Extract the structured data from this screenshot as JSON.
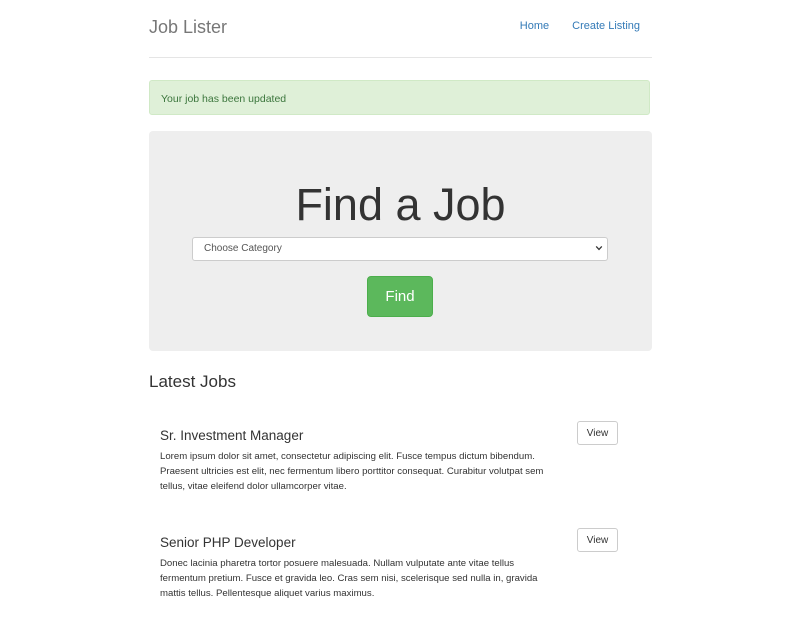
{
  "header": {
    "brand": "Job Lister",
    "nav": [
      "Home",
      "Create Listing"
    ]
  },
  "alert": {
    "message": "Your job has been updated"
  },
  "search": {
    "title": "Find a Job",
    "category_selected": "Choose Category",
    "find_label": "Find"
  },
  "latest": {
    "title": "Latest Jobs",
    "jobs": [
      {
        "title": "Sr. Investment Manager",
        "description": "Lorem ipsum dolor sit amet, consectetur adipiscing elit. Fusce tempus dictum bibendum. Praesent ultricies est elit, nec fermentum libero porttitor consequat. Curabitur volutpat sem tellus, vitae eleifend dolor ullamcorper vitae.",
        "action": "View"
      },
      {
        "title": "Senior PHP Developer",
        "description": "Donec lacinia pharetra tortor posuere malesuada. Nullam vulputate ante vitae tellus fermentum pretium. Fusce et gravida leo. Cras sem nisi, scelerisque sed nulla in, gravida mattis tellus. Pellentesque aliquet varius maximus.",
        "action": "View"
      }
    ]
  },
  "colors": {
    "link": "#337ab7",
    "success_bg": "#dff0d8",
    "success_text": "#3c763d",
    "find_button": "#5cb85c",
    "jumbotron_bg": "#eeeeee"
  },
  "icons": {
    "select_arrow": "chevron-down-icon"
  }
}
